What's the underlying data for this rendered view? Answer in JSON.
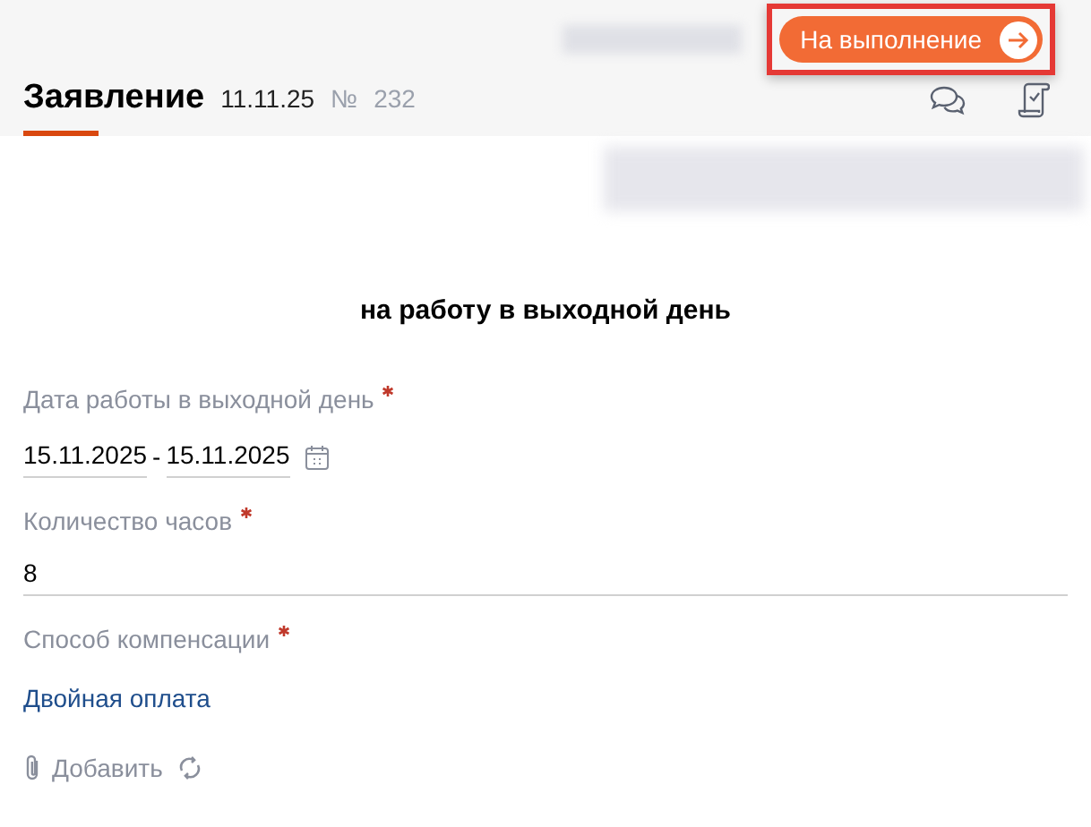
{
  "header": {
    "action_button": {
      "label": "На выполнение",
      "highlighted": true
    },
    "title": "Заявление",
    "date": "11.11.25",
    "number_sign": "№",
    "number": "232"
  },
  "document_title": "на работу в выходной день",
  "fields": [
    {
      "kind": "daterange",
      "label": "Дата работы в выходной день",
      "required": true,
      "from": "15.11.2025",
      "separator": "-",
      "to": "15.11.2025"
    },
    {
      "kind": "text",
      "label": "Количество часов",
      "required": true,
      "value": "8"
    },
    {
      "kind": "link",
      "label": "Способ компенсации",
      "required": true,
      "value": "Двойная оплата"
    }
  ],
  "attachments": {
    "add_label": "Добавить"
  }
}
